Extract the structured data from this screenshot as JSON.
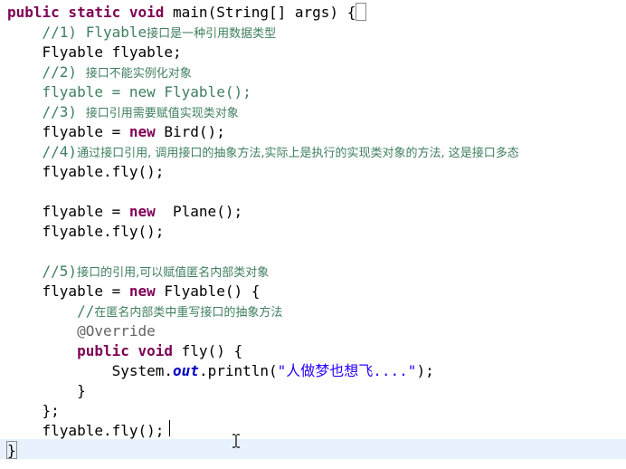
{
  "editor": {
    "lines": [
      {
        "segments": [
          {
            "t": "public static void ",
            "c": "kw"
          },
          {
            "t": "main(String[] args) {",
            "c": "plain"
          }
        ]
      },
      {
        "segments": [
          {
            "t": "    //1) Flyable",
            "c": "cm"
          },
          {
            "t": "接口是一种引用数据类型",
            "c": "cmcjk"
          }
        ]
      },
      {
        "segments": [
          {
            "t": "    Flyable flyable;",
            "c": "plain"
          }
        ]
      },
      {
        "segments": [
          {
            "t": "    //2) ",
            "c": "cm"
          },
          {
            "t": "接口不能实例化对象",
            "c": "cmcjk"
          }
        ]
      },
      {
        "segments": [
          {
            "t": "    flyable = new Flyable();",
            "c": "cm"
          }
        ]
      },
      {
        "segments": [
          {
            "t": "    //3) ",
            "c": "cm"
          },
          {
            "t": "接口引用需要赋值实现类对象",
            "c": "cmcjk"
          }
        ]
      },
      {
        "segments": [
          {
            "t": "    flyable = ",
            "c": "plain"
          },
          {
            "t": "new ",
            "c": "kw"
          },
          {
            "t": "Bird();",
            "c": "plain"
          }
        ]
      },
      {
        "segments": [
          {
            "t": "    //4)",
            "c": "cm"
          },
          {
            "t": "通过接口引用, 调用接口的抽象方法,实际上是执行的实现类对象的方法, 这是接口多态",
            "c": "cmcjk"
          }
        ]
      },
      {
        "segments": [
          {
            "t": "    flyable.fly();",
            "c": "plain"
          }
        ]
      },
      {
        "segments": [
          {
            "t": "",
            "c": "plain"
          }
        ]
      },
      {
        "segments": [
          {
            "t": "    flyable = ",
            "c": "plain"
          },
          {
            "t": "new ",
            "c": "kw"
          },
          {
            "t": " Plane();",
            "c": "plain"
          }
        ]
      },
      {
        "segments": [
          {
            "t": "    flyable.fly();",
            "c": "plain"
          }
        ]
      },
      {
        "segments": [
          {
            "t": "",
            "c": "plain"
          }
        ]
      },
      {
        "segments": [
          {
            "t": "    //5)",
            "c": "cm"
          },
          {
            "t": "接口的引用,可以赋值匿名内部类对象",
            "c": "cmcjk"
          }
        ]
      },
      {
        "segments": [
          {
            "t": "    flyable = ",
            "c": "plain"
          },
          {
            "t": "new ",
            "c": "kw"
          },
          {
            "t": "Flyable() {",
            "c": "plain"
          }
        ]
      },
      {
        "segments": [
          {
            "t": "        //",
            "c": "cm"
          },
          {
            "t": "在匿名内部类中重写接口的抽象方法",
            "c": "cmcjk"
          }
        ]
      },
      {
        "segments": [
          {
            "t": "        @Override",
            "c": "ann"
          }
        ]
      },
      {
        "segments": [
          {
            "t": "        public void ",
            "c": "kw"
          },
          {
            "t": "fly() {",
            "c": "plain"
          }
        ]
      },
      {
        "segments": [
          {
            "t": "            System.",
            "c": "plain"
          },
          {
            "t": "out",
            "c": "static-field"
          },
          {
            "t": ".println(",
            "c": "plain"
          },
          {
            "t": "\"人做梦也想飞....\"",
            "c": "str"
          },
          {
            "t": ");",
            "c": "plain"
          }
        ]
      },
      {
        "segments": [
          {
            "t": "        }",
            "c": "plain"
          }
        ]
      },
      {
        "segments": [
          {
            "t": "    };",
            "c": "plain"
          }
        ]
      },
      {
        "segments": [
          {
            "t": "    flyable.fly();",
            "c": "plain"
          }
        ]
      },
      {
        "segments": [
          {
            "t": "}",
            "c": "plain"
          }
        ]
      }
    ]
  },
  "colors": {
    "keyword": "#7f0055",
    "comment": "#3f7f5f",
    "annotation": "#646464",
    "string": "#2a00ff",
    "static_field": "#0000c0",
    "current_line": "#e8f2fe"
  }
}
